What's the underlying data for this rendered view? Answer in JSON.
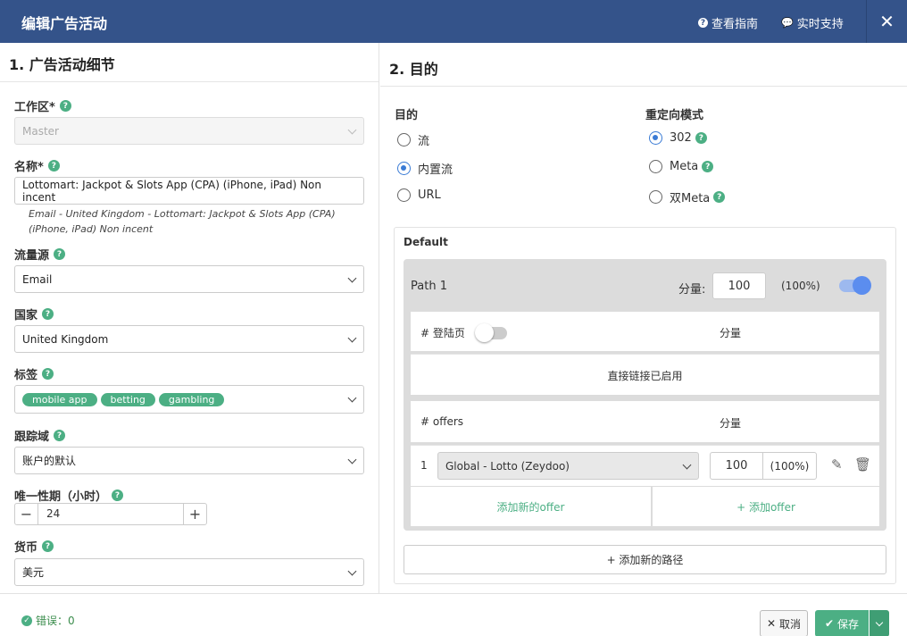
{
  "header": {
    "title": "编辑广告活动",
    "guide_label": "查看指南",
    "support_label": "实时支持",
    "close_glyph": "✕"
  },
  "left": {
    "section_title": "1. 广告活动细节",
    "workspace": {
      "label": "工作区*",
      "value": "Master"
    },
    "name": {
      "label": "名称*",
      "value": "Lottomart: Jackpot & Slots App (CPA) (iPhone, iPad) Non incent",
      "description": "Email - United Kingdom - Lottomart: Jackpot & Slots App (CPA) (iPhone, iPad) Non incent"
    },
    "traffic_source": {
      "label": "流量源",
      "value": "Email"
    },
    "country": {
      "label": "国家",
      "value": "United Kingdom"
    },
    "tags": {
      "label": "标签",
      "values": [
        "mobile app",
        "betting",
        "gambling"
      ]
    },
    "tracking_domain": {
      "label": "跟踪域",
      "value": "账户的默认"
    },
    "uniqueness": {
      "label": "唯一性期（小时）",
      "value": "24",
      "minus": "−",
      "plus": "+"
    },
    "currency": {
      "label": "货币",
      "value": "美元"
    }
  },
  "right": {
    "section_title": "2. 目的",
    "destination": {
      "label": "目的",
      "options": [
        "流",
        "内置流",
        "URL"
      ],
      "selected": "内置流"
    },
    "redirect": {
      "label": "重定向模式",
      "options": [
        "302",
        "Meta",
        "双Meta"
      ],
      "selected": "302"
    },
    "default_label": "Default",
    "path": {
      "name": "Path 1",
      "weight_label": "分量:",
      "weight_value": "100",
      "weight_percent": "(100%)",
      "enabled": true,
      "landers_header": "# 登陆页",
      "landers_enabled": false,
      "weight_col": "分量",
      "direct_link": "直接链接已启用",
      "offers_header": "# offers",
      "offers": [
        {
          "index": "1",
          "name": "Global - Lotto (Zeydoo)",
          "weight": "100",
          "percent": "(100%)"
        }
      ],
      "add_new_offer": "添加新的offer",
      "add_offer": "+ 添加offer"
    },
    "add_path": "+ 添加新的路径"
  },
  "footer": {
    "errors_label": "错误：0",
    "cancel": "取消",
    "save": "保存"
  },
  "colors": {
    "header_bg": "#34538a",
    "accent_green": "#4caf84",
    "toggle_blue": "#5b8def"
  }
}
